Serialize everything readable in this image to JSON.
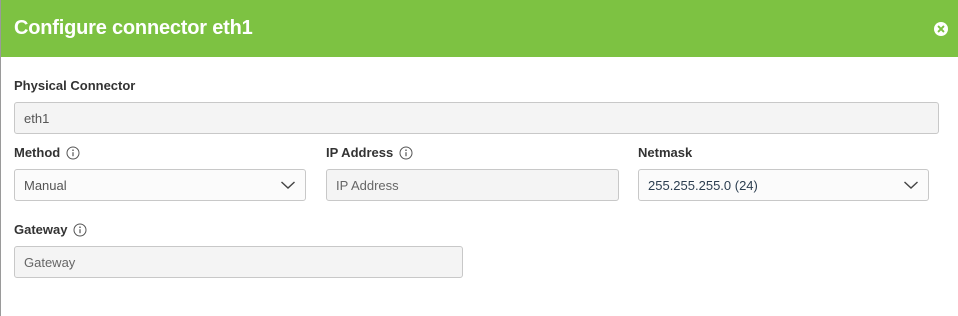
{
  "dialog": {
    "title": "Configure connector eth1"
  },
  "form": {
    "physical_connector": {
      "label": "Physical Connector",
      "value": "eth1"
    },
    "method": {
      "label": "Method",
      "selected": "Manual"
    },
    "ip_address": {
      "label": "IP Address",
      "placeholder": "IP Address"
    },
    "netmask": {
      "label": "Netmask",
      "selected": "255.255.255.0 (24)"
    },
    "gateway": {
      "label": "Gateway",
      "placeholder": "Gateway"
    }
  },
  "colors": {
    "header_bg": "#7dc242",
    "field_bg": "#f4f4f4",
    "field_border": "#c8c8c8"
  },
  "icons": [
    "close-icon",
    "info-icon",
    "chevron-down-icon"
  ]
}
